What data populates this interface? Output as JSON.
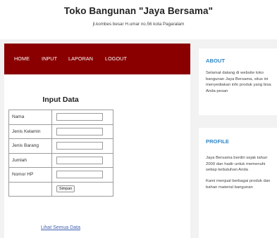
{
  "header": {
    "title": "Toko Bangunan \"Jaya Bersama\"",
    "address": "jl.kombes besar H.umar no.56 kota Pagaralam"
  },
  "nav": {
    "items": [
      "HOME",
      "INPUT",
      "LAPORAN",
      "LOGOUT"
    ]
  },
  "form": {
    "title": "Input Data",
    "fields": [
      "Nama",
      "Jenis Kelamin",
      "Jenis Barang",
      "Jumlah",
      "Nomor HP"
    ],
    "values": [
      "",
      "",
      "",
      "",
      ""
    ],
    "submit_label": "Simpan"
  },
  "view_all_link": "Lihat Semua Data",
  "sidebar": {
    "about": {
      "title": "ABOUT",
      "text": "Selamat datang di website toko bangunan Jaya Bersama, situs ini menyediakan info produk yang bisa Anda pesan"
    },
    "profile": {
      "title": "PROFILE",
      "paragraphs": [
        "Jaya Bersama berdiri sejak tahun 2000 dan hadir untuk memenuhi setiap kebutuhan Anda",
        "Kami menjual berbagai produk dan bahan material bangunan"
      ]
    }
  },
  "colors": {
    "nav_background": "#8a0000",
    "sidebar_heading": "#2f86c8",
    "link": "#4060b0",
    "page_background": "#f2f2f2"
  }
}
